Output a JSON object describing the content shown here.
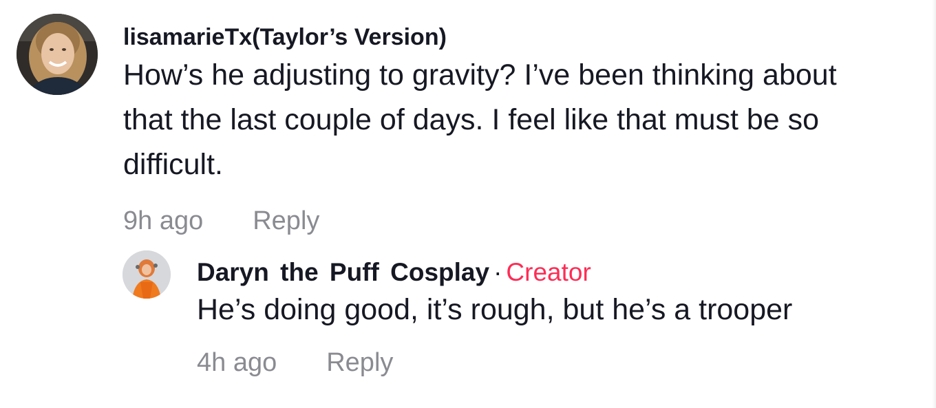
{
  "comments": [
    {
      "username": "lisamarieTx(Taylor’s Version)",
      "text": "How’s he adjusting to gravity? I’ve been thinking about that the last couple of days. I feel like that must be so difficult.",
      "time": "9h ago",
      "reply_label": "Reply",
      "avatar_icon": "user-avatar-photo"
    }
  ],
  "reply": {
    "username": "Daryn the Puff Cosplay",
    "separator": "·",
    "badge": "Creator",
    "text": "He’s doing good, it’s rough, but he’s a trooper",
    "time": "4h ago",
    "reply_label": "Reply",
    "avatar_icon": "creator-avatar-photo"
  },
  "colors": {
    "text_primary": "#161823",
    "text_secondary": "#8a8b91",
    "creator_accent": "#fe2c55",
    "background": "#ffffff"
  }
}
